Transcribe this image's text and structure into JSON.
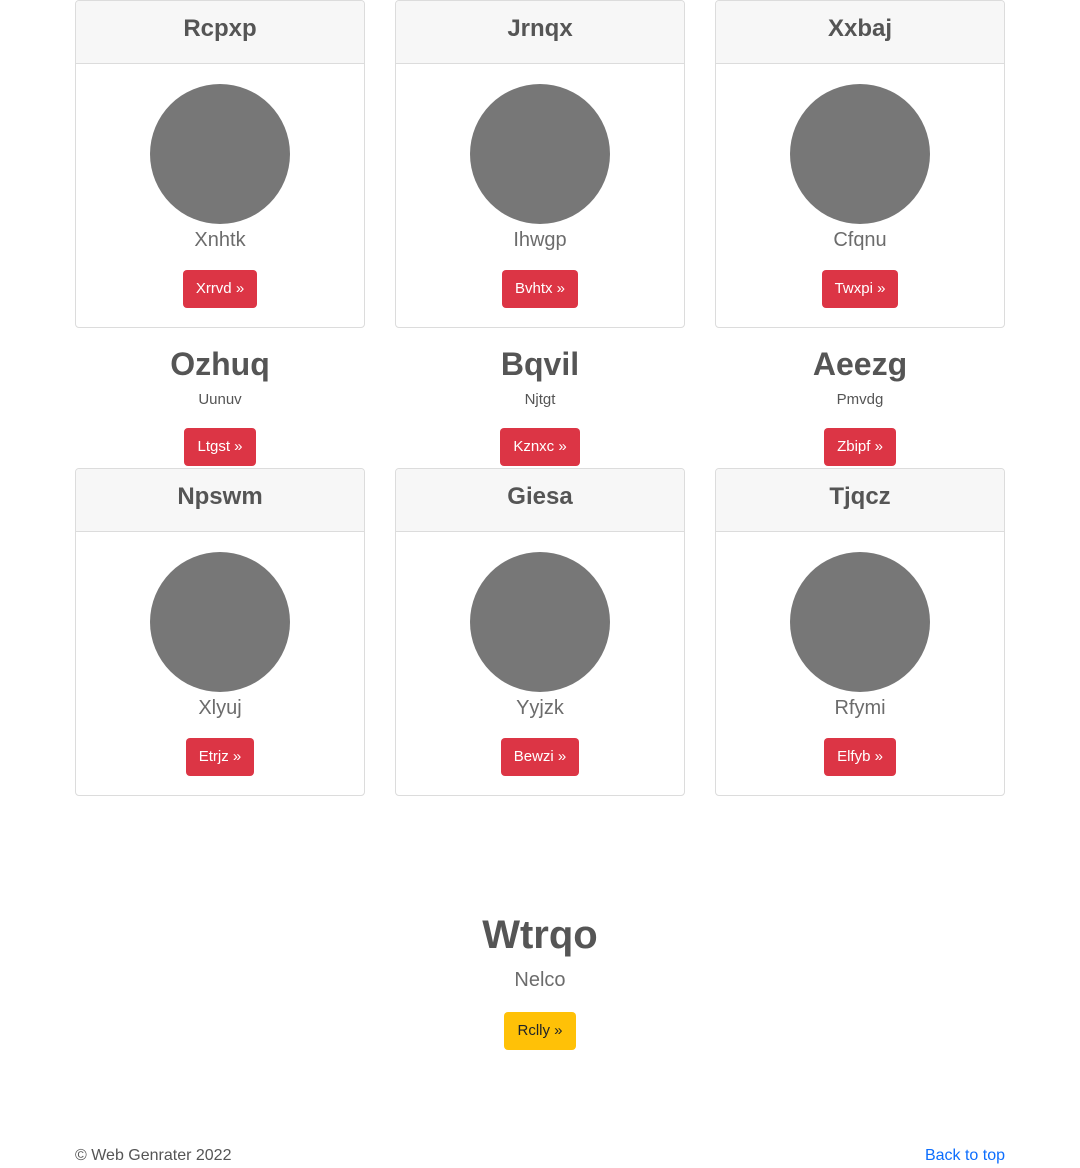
{
  "cards_row1": [
    {
      "title": "Rcpxp",
      "subtitle": "Xnhtk",
      "button": "Xrrvd »"
    },
    {
      "title": "Jrnqx",
      "subtitle": "Ihwgp",
      "button": "Bvhtx »"
    },
    {
      "title": "Xxbaj",
      "subtitle": "Cfqnu",
      "button": "Twxpi »"
    }
  ],
  "text_blocks": [
    {
      "title": "Ozhuq",
      "subtitle": "Uunuv",
      "button": "Ltgst »"
    },
    {
      "title": "Bqvil",
      "subtitle": "Njtgt",
      "button": "Kznxc »"
    },
    {
      "title": "Aeezg",
      "subtitle": "Pmvdg",
      "button": "Zbipf »"
    }
  ],
  "cards_row2": [
    {
      "title": "Npswm",
      "subtitle": "Xlyuj",
      "button": "Etrjz »"
    },
    {
      "title": "Giesa",
      "subtitle": "Yyjzk",
      "button": "Bewzi »"
    },
    {
      "title": "Tjqcz",
      "subtitle": "Rfymi",
      "button": "Elfyb »"
    }
  ],
  "hero": {
    "title": "Wtrqo",
    "subtitle": "Nelco",
    "button": "Rclly »"
  },
  "footer": {
    "copyright": "© Web Genrater 2022",
    "back_to_top": "Back to top"
  },
  "colors": {
    "danger": "#dc3545",
    "warning": "#ffc107",
    "link": "#0d6efd",
    "avatar": "#777777"
  }
}
